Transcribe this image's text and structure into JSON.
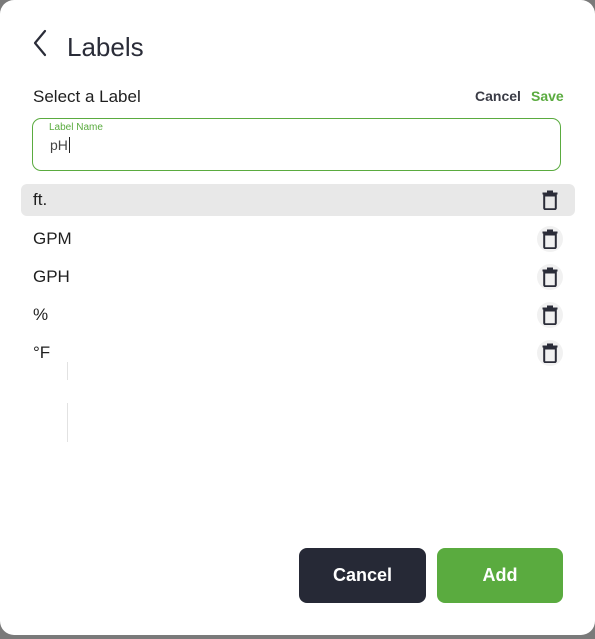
{
  "header": {
    "title": "Labels"
  },
  "subheader": {
    "text": "Select a Label",
    "cancel_label": "Cancel",
    "save_label": "Save"
  },
  "field": {
    "label": "Label Name",
    "value": "pH"
  },
  "labels": [
    {
      "text": "ft.",
      "selected": true
    },
    {
      "text": "GPM",
      "selected": false
    },
    {
      "text": "GPH",
      "selected": false
    },
    {
      "text": "%",
      "selected": false
    },
    {
      "text": "°F",
      "selected": false
    }
  ],
  "footer": {
    "cancel_label": "Cancel",
    "add_label": "Add"
  },
  "colors": {
    "accent": "#5aab3f",
    "dark_button": "#262936",
    "selected_row": "#e8e8e8"
  }
}
